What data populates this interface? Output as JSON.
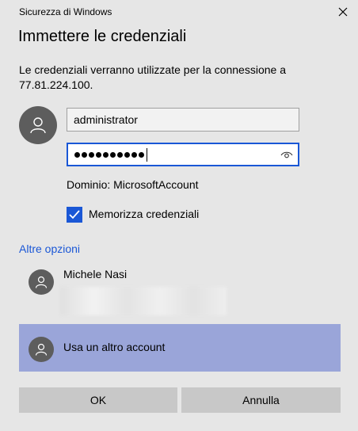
{
  "window": {
    "title": "Sicurezza di Windows",
    "close_icon": "close-icon"
  },
  "dialog": {
    "heading": "Immettere le credenziali",
    "message": "Le credenziali verranno utilizzate per la connessione a 77.81.224.100."
  },
  "form": {
    "username_value": "administrator",
    "password_mask_count": 10,
    "reveal_icon": "eye-icon",
    "domain_text": "Dominio: MicrosoftAccount",
    "remember_label": "Memorizza credenziali",
    "remember_checked": true
  },
  "options": {
    "more_link": "Altre opzioni",
    "accounts": [
      {
        "name": "Michele Nasi",
        "icon": "user-icon"
      }
    ],
    "other_account_label": "Usa un altro account",
    "other_account_bg": "#9aa5d9"
  },
  "buttons": {
    "ok": "OK",
    "cancel": "Annulla"
  },
  "colors": {
    "accent": "#1a57d6",
    "background": "#e6e6e6",
    "avatar": "#5d5d5d"
  }
}
